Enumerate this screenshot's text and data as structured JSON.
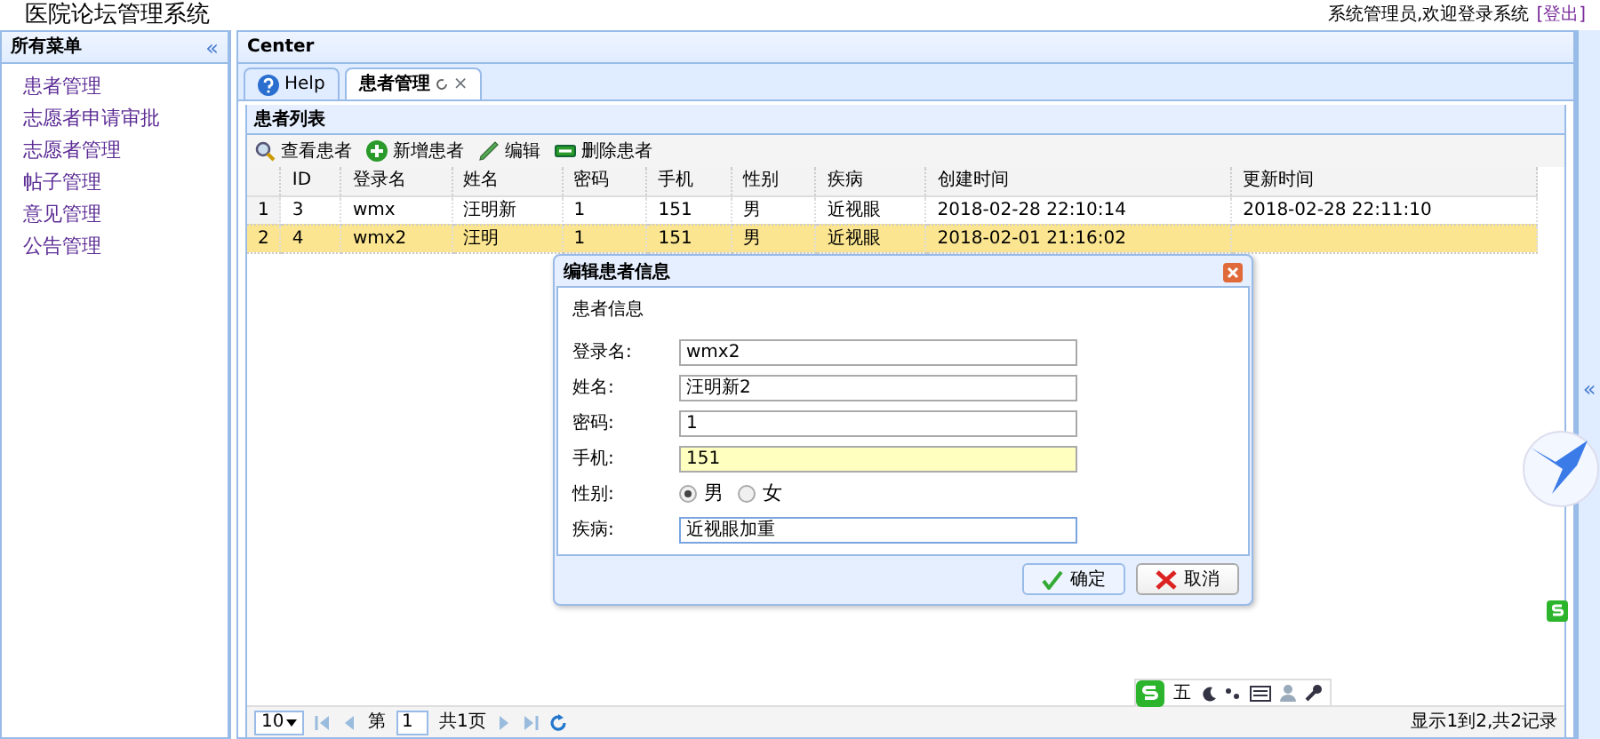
{
  "header": {
    "title": "医院论坛管理系统",
    "user_text": "系统管理员,欢迎登录系统",
    "logout_link": "[登出]"
  },
  "sidebar": {
    "title": "所有菜单",
    "collapse": "«",
    "items": [
      {
        "label": "患者管理",
        "selected": false
      },
      {
        "label": "志愿者申请审批",
        "selected": false
      },
      {
        "label": "志愿者管理",
        "selected": false
      },
      {
        "label": "帖子管理",
        "selected": false
      },
      {
        "label": "意见管理",
        "selected": false
      },
      {
        "label": "公告管理",
        "selected": false
      }
    ]
  },
  "center": {
    "title": "Center",
    "collapse": "«",
    "tabs": [
      {
        "label": "Help",
        "kind": "help",
        "selected": false
      },
      {
        "label": "患者管理",
        "kind": "closable",
        "close": "×",
        "selected": true
      }
    ],
    "panel_title": "患者列表",
    "toolbar": [
      {
        "label": "查看患者",
        "kind": "search"
      },
      {
        "label": "新增患者",
        "kind": "add"
      },
      {
        "label": "编辑",
        "kind": "edit"
      },
      {
        "label": "删除患者",
        "kind": "remove"
      }
    ],
    "table": {
      "columns": [
        "ID",
        "登录名",
        "姓名",
        "密码",
        "手机",
        "性别",
        "疾病",
        "创建时间",
        "更新时间"
      ],
      "rows": [
        {
          "number": "1",
          "selected": false,
          "cells": [
            "3",
            "wmx",
            "汪明新",
            "1",
            "151",
            "男",
            "近视眼",
            "2018-02-28 22:10:14",
            "2018-02-28 22:11:10"
          ]
        },
        {
          "number": "2",
          "selected": true,
          "cells": [
            "4",
            "wmx2",
            "汪明",
            "1",
            "151",
            "男",
            "近视眼",
            "2018-02-01 21:16:02",
            ""
          ]
        }
      ]
    },
    "pager": {
      "page_size": "10",
      "page_prefix": "第",
      "page": "1",
      "page_suffix": "共1页",
      "summary": "显示1到2,共2记录"
    }
  },
  "dialog": {
    "title": "编辑患者信息",
    "legend": "患者信息",
    "fields": [
      {
        "kind": "text",
        "label": "登录名:",
        "value": "wmx2",
        "highlighted": false,
        "focused": false
      },
      {
        "kind": "text",
        "label": "姓名:",
        "value": "汪明新2",
        "highlighted": false,
        "focused": false
      },
      {
        "kind": "text",
        "label": "密码:",
        "value": "1",
        "highlighted": false,
        "focused": false
      },
      {
        "kind": "text",
        "label": "手机:",
        "value": "151",
        "highlighted": true,
        "focused": false
      },
      {
        "kind": "radio",
        "label": "性别:",
        "options": [
          {
            "label": "男",
            "selected": true
          },
          {
            "label": "女",
            "selected": false
          }
        ]
      },
      {
        "kind": "text",
        "label": "疾病:",
        "value": "近视眼加重",
        "highlighted": false,
        "focused": true
      }
    ],
    "buttons": [
      {
        "label": "确定",
        "kind": "ok"
      },
      {
        "label": "取消",
        "kind": "cancel"
      }
    ]
  },
  "ime_toolbar": {
    "mode": "五"
  }
}
